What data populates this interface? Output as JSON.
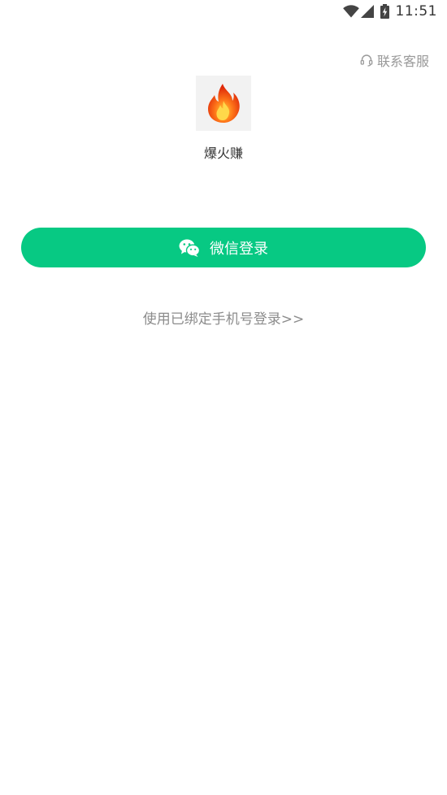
{
  "status_bar": {
    "time": "11:51",
    "icons": [
      "wifi-icon",
      "signal-icon",
      "battery-charging-icon"
    ]
  },
  "header": {
    "support_label": "联系客服",
    "support_icon": "headset-icon"
  },
  "app": {
    "logo_icon": "flame-icon",
    "name": "爆火赚"
  },
  "login": {
    "wechat_label": "微信登录",
    "wechat_icon": "wechat-icon",
    "phone_link": "使用已绑定手机号登录>>"
  },
  "colors": {
    "brand_green": "#07c983",
    "secondary_text": "#999999",
    "primary_text": "#333333",
    "flame_outer": "#e8350c",
    "flame_inner": "#ffb020"
  }
}
